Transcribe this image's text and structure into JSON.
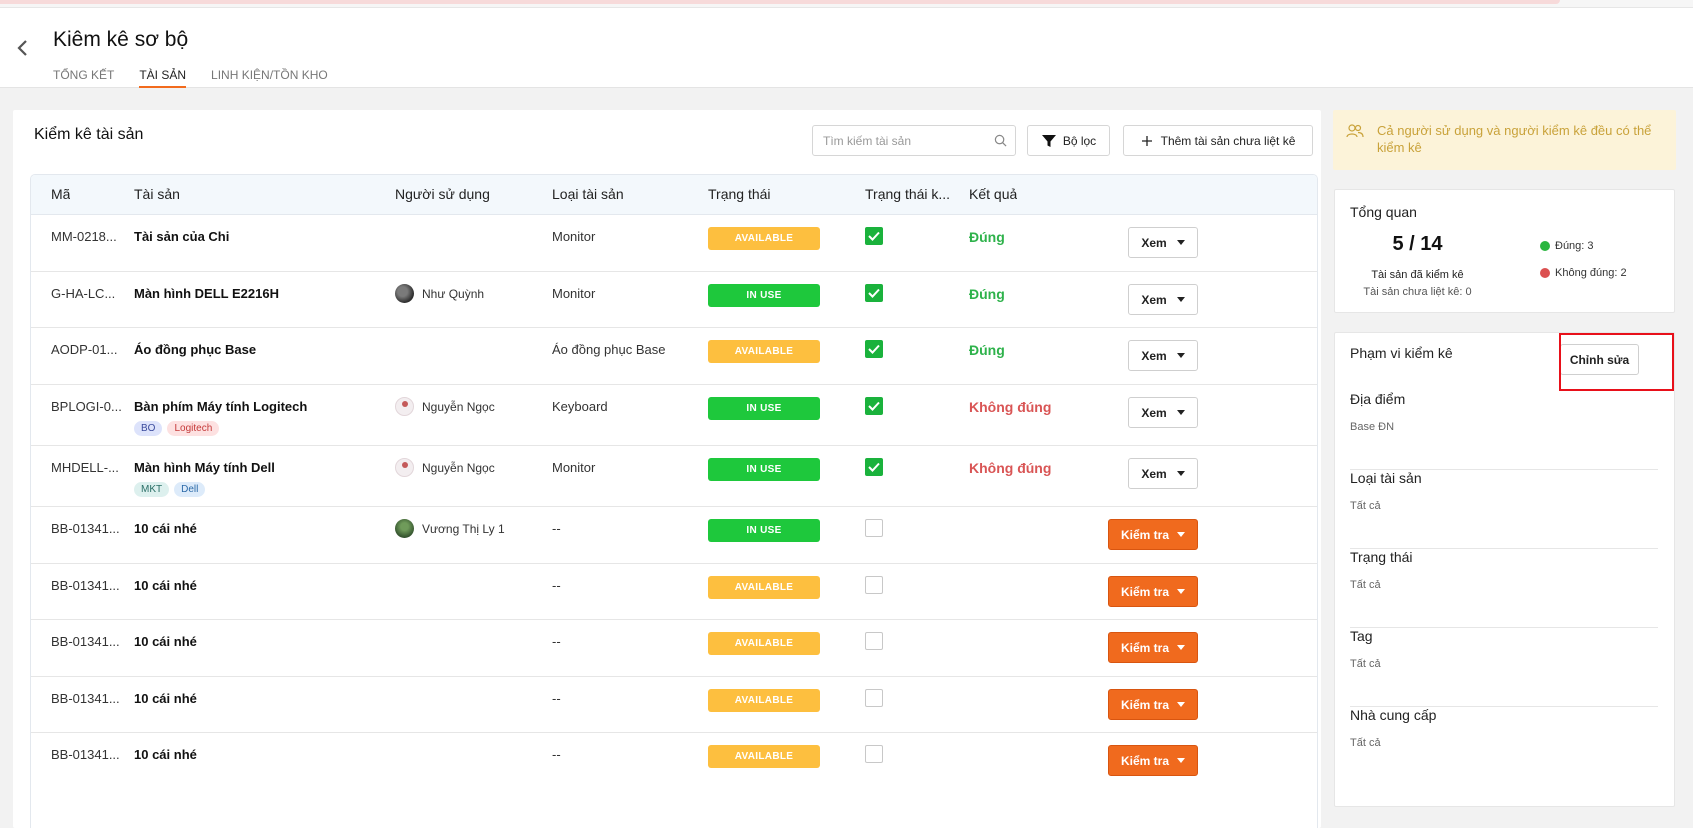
{
  "header": {
    "back_icon": "chevron-left-icon",
    "title": "Kiêm kê sơ bộ",
    "tabs": [
      {
        "label": "TỔNG KẾT",
        "active": false
      },
      {
        "label": "TÀI SẢN",
        "active": true
      },
      {
        "label": "LINH KIỆN/TỒN KHO",
        "active": false
      }
    ]
  },
  "main": {
    "title": "Kiểm kê tài sản",
    "search": {
      "placeholder": "Tìm kiếm tài sản",
      "value": ""
    },
    "filter_label": "Bộ lọc",
    "add_label": "Thêm tài sản chưa liệt kê",
    "columns": [
      "Mã",
      "Tài sản",
      "Người sử dụng",
      "Loại tài sản",
      "Trạng thái",
      "Trạng thái k...",
      "Kết quả"
    ],
    "rows": [
      {
        "code": "MM-0218...",
        "name": "Tài sản của Chi",
        "user": "",
        "type": "Monitor",
        "status": "AVAILABLE",
        "checked": true,
        "result": "Đúng",
        "action": "Xem"
      },
      {
        "code": "G-HA-LC...",
        "name": "Màn hình DELL E2216H",
        "user": "Như Quỳnh",
        "type": "Monitor",
        "status": "IN USE",
        "checked": true,
        "result": "Đúng",
        "action": "Xem"
      },
      {
        "code": "AODP-01...",
        "name": "Áo đồng phục Base",
        "user": "",
        "type": "Áo đồng phục Base",
        "status": "AVAILABLE",
        "checked": true,
        "result": "Đúng",
        "action": "Xem"
      },
      {
        "code": "BPLOGI-0...",
        "name": "Bàn phím Máy tính Logitech",
        "user": "Nguyễn Ngọc",
        "type": "Keyboard",
        "status": "IN USE",
        "checked": true,
        "result": "Không đúng",
        "action": "Xem",
        "tags": [
          "BO",
          "Logitech"
        ]
      },
      {
        "code": "MHDELL-...",
        "name": "Màn hình Máy tính Dell",
        "user": "Nguyễn Ngọc",
        "type": "Monitor",
        "status": "IN USE",
        "checked": true,
        "result": "Không đúng",
        "action": "Xem",
        "tags": [
          "MKT",
          "Dell"
        ]
      },
      {
        "code": "BB-01341...",
        "name": "10 cái nhé",
        "user": "Vương Thị Ly 1",
        "type": "--",
        "status": "IN USE",
        "checked": false,
        "result": "",
        "action": "Kiểm tra"
      },
      {
        "code": "BB-01341...",
        "name": "10 cái nhé",
        "user": "",
        "type": "--",
        "status": "AVAILABLE",
        "checked": false,
        "result": "",
        "action": "Kiểm tra"
      },
      {
        "code": "BB-01341...",
        "name": "10 cái nhé",
        "user": "",
        "type": "--",
        "status": "AVAILABLE",
        "checked": false,
        "result": "",
        "action": "Kiểm tra"
      },
      {
        "code": "BB-01341...",
        "name": "10 cái nhé",
        "user": "",
        "type": "--",
        "status": "AVAILABLE",
        "checked": false,
        "result": "",
        "action": "Kiểm tra"
      },
      {
        "code": "BB-01341...",
        "name": "10 cái nhé",
        "user": "",
        "type": "--",
        "status": "AVAILABLE",
        "checked": false,
        "result": "",
        "action": "Kiểm tra"
      }
    ]
  },
  "sidebar": {
    "notice": "Cả người sử dụng và người kiểm kê đều có thể kiểm kê",
    "overview": {
      "title": "Tổng quan",
      "count": "5 / 14",
      "checked_label": "Tài sản đã kiểm kê",
      "unlisted_label": "Tài sản chưa liệt kê: 0",
      "correct": "Đúng: 3",
      "incorrect": "Không đúng: 2"
    },
    "scope": {
      "title": "Phạm vi kiểm kê",
      "edit_label": "Chỉnh sửa",
      "items": [
        {
          "label": "Địa điểm",
          "value": "Base ĐN"
        },
        {
          "label": "Loại tài sản",
          "value": "Tất cả"
        },
        {
          "label": "Trạng thái",
          "value": "Tất cả"
        },
        {
          "label": "Tag",
          "value": "Tất cả"
        },
        {
          "label": "Nhà cung cấp",
          "value": "Tất cả"
        }
      ]
    }
  },
  "colors": {
    "accent": "#f06a1e",
    "available": "#fdbf3f",
    "in_use": "#1ec83c",
    "correct": "#2eb24b",
    "incorrect": "#d95555",
    "highlight": "#e8101a"
  }
}
